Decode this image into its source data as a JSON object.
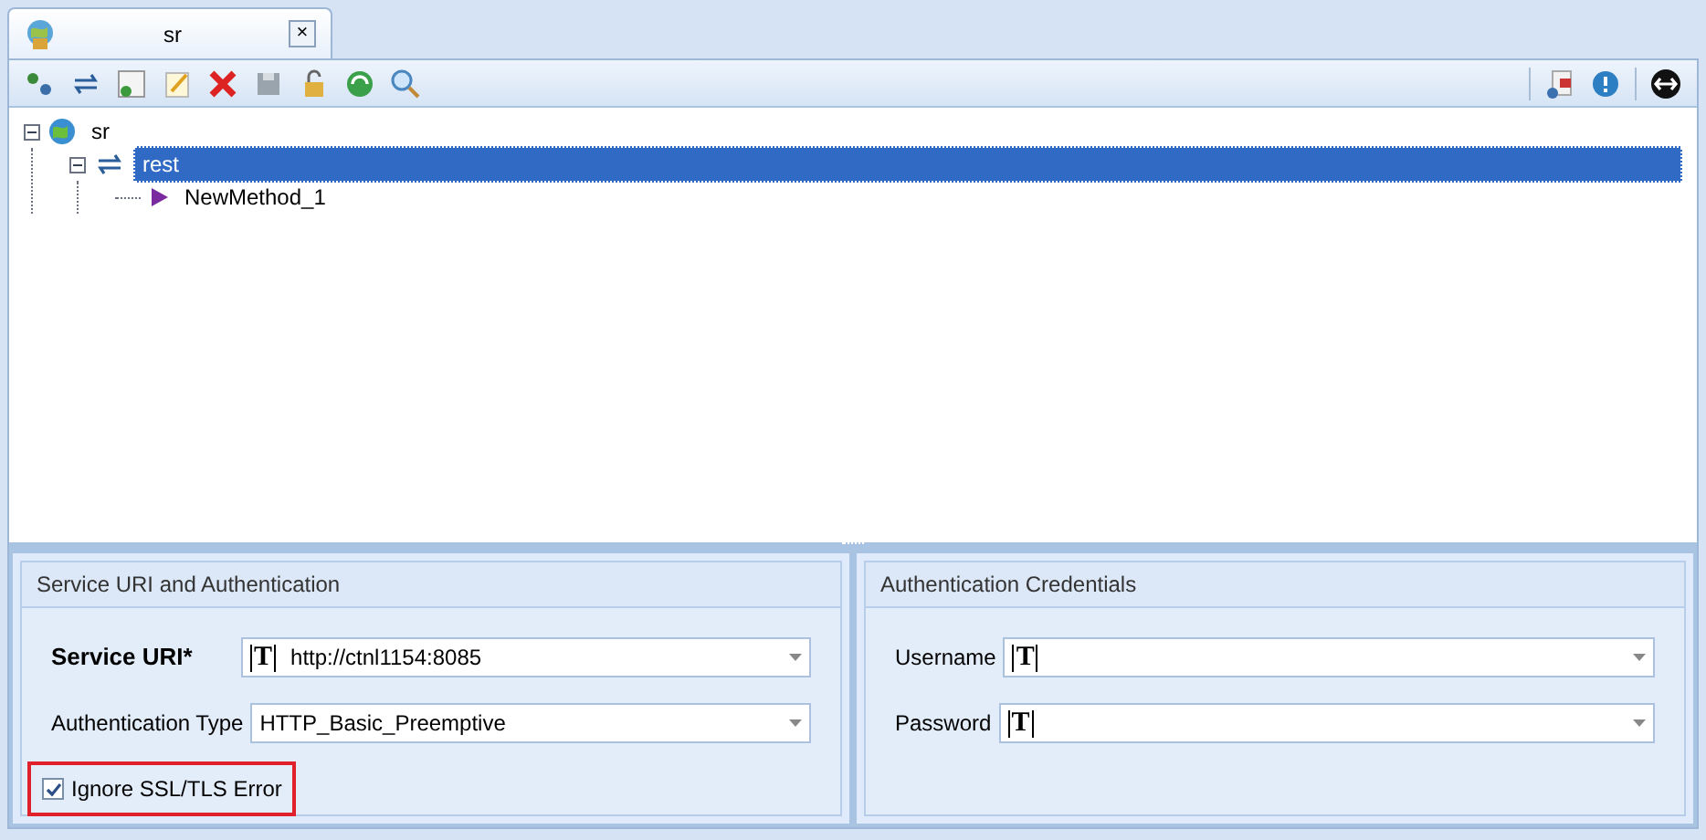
{
  "tab": {
    "title": "sr",
    "close": "×"
  },
  "tree": [
    {
      "label": "sr",
      "kind": "service",
      "expanded": true,
      "selected": false,
      "children": [
        {
          "label": "rest",
          "kind": "rest",
          "expanded": true,
          "selected": true,
          "children": [
            {
              "label": "NewMethod_1",
              "kind": "method",
              "selected": false
            }
          ]
        }
      ]
    }
  ],
  "left_panel": {
    "title": "Service URI and Authentication",
    "fields": [
      {
        "label": "Service URI*",
        "bold": true,
        "glyph": "T",
        "value": "http://ctnl1154:8085"
      },
      {
        "label": "Authentication Type",
        "bold": false,
        "value": "HTTP_Basic_Preemptive"
      }
    ],
    "checkbox": {
      "label": "Ignore SSL/TLS Error",
      "checked": true,
      "highlighted": true
    }
  },
  "right_panel": {
    "title": "Authentication Credentials",
    "fields": [
      {
        "label": "Username",
        "bold": false,
        "glyph": "T"
      },
      {
        "label": "Password",
        "bold": false,
        "glyph": "T"
      }
    ]
  }
}
